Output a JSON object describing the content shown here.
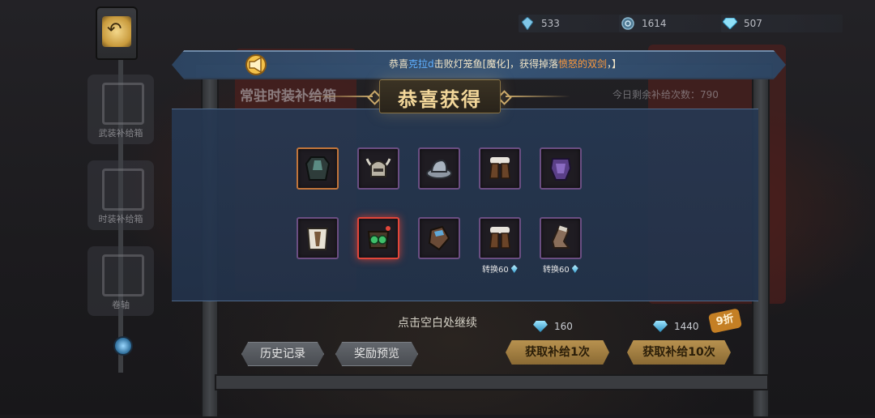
{
  "resources": [
    {
      "icon": "crystal-shard-icon",
      "value": "533"
    },
    {
      "icon": "coin-icon",
      "value": "1614"
    },
    {
      "icon": "diamond-icon",
      "value": "507"
    }
  ],
  "sidebar": {
    "items": [
      {
        "label": "武装补给箱"
      },
      {
        "label": "时装补给箱"
      },
      {
        "label": "卷轴"
      }
    ]
  },
  "underlying": {
    "title": "常驻时装补给箱",
    "remaining_label": "今日剩余补给次数：790"
  },
  "broadcast": {
    "prefix": "恭喜",
    "player": "克拉d",
    "middle": "击败灯笼鱼[魔化]，获得掉落",
    "item": "愤怒的双剑",
    "suffix": "，】"
  },
  "popup": {
    "title": "恭喜获得",
    "items": [
      {
        "icon": "armor-vest-icon",
        "rarity": "orange"
      },
      {
        "icon": "horned-helmet-icon",
        "rarity": "purple"
      },
      {
        "icon": "hat-icon",
        "rarity": "purple"
      },
      {
        "icon": "fur-boots-icon",
        "rarity": "purple"
      },
      {
        "icon": "purple-armor-icon",
        "rarity": "purple"
      },
      {
        "icon": "white-cloak-icon",
        "rarity": "purple"
      },
      {
        "icon": "goggles-mask-icon",
        "rarity": "red"
      },
      {
        "icon": "bracer-icon",
        "rarity": "purple"
      },
      {
        "icon": "fur-boots-icon",
        "rarity": "purple",
        "convert": "转换60"
      },
      {
        "icon": "boot-icon",
        "rarity": "purple",
        "convert": "转换60"
      }
    ],
    "continue_text": "点击空白处继续"
  },
  "bottom": {
    "history_button": "历史记录",
    "preview_button": "奖励预览",
    "draw1_cost": "160",
    "draw10_cost": "1440",
    "discount": "9折",
    "draw1_button": "获取补给1次",
    "draw10_button": "获取补给10次"
  },
  "colors": {
    "rarity_purple": "#6b4e82",
    "rarity_orange": "#c2753a",
    "rarity_red": "#e2463a",
    "title_gold": "#f3d79a",
    "player_blue": "#5fb0ff",
    "item_orange": "#ff9a3c"
  }
}
